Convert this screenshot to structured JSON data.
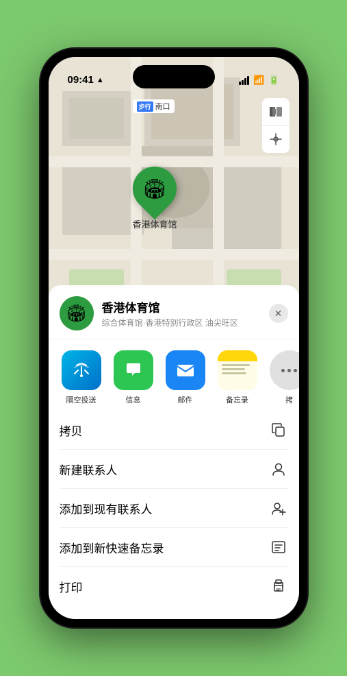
{
  "status_bar": {
    "time": "09:41",
    "location_arrow": "▲"
  },
  "map": {
    "label_badge": "步行",
    "label_text": "南口",
    "pin_label": "香港体育馆",
    "controls": {
      "map_icon": "🗺",
      "location_icon": "➤"
    }
  },
  "sheet": {
    "icon": "🏟",
    "title": "香港体育馆",
    "subtitle": "综合体育馆·香港特别行政区 油尖旺区",
    "close_icon": "✕"
  },
  "share_items": [
    {
      "id": "airdrop",
      "label": "隔空投送",
      "icon": "📡"
    },
    {
      "id": "messages",
      "label": "信息",
      "icon": "💬"
    },
    {
      "id": "mail",
      "label": "邮件",
      "icon": "✉"
    },
    {
      "id": "notes",
      "label": "备忘录",
      "selected": true
    },
    {
      "id": "more",
      "label": "拷"
    }
  ],
  "actions": [
    {
      "id": "copy",
      "label": "拷贝",
      "icon": "copy"
    },
    {
      "id": "new-contact",
      "label": "新建联系人",
      "icon": "person"
    },
    {
      "id": "add-existing",
      "label": "添加到现有联系人",
      "icon": "person-add"
    },
    {
      "id": "add-notes",
      "label": "添加到新快速备忘录",
      "icon": "notes"
    },
    {
      "id": "print",
      "label": "打印",
      "icon": "print"
    }
  ]
}
